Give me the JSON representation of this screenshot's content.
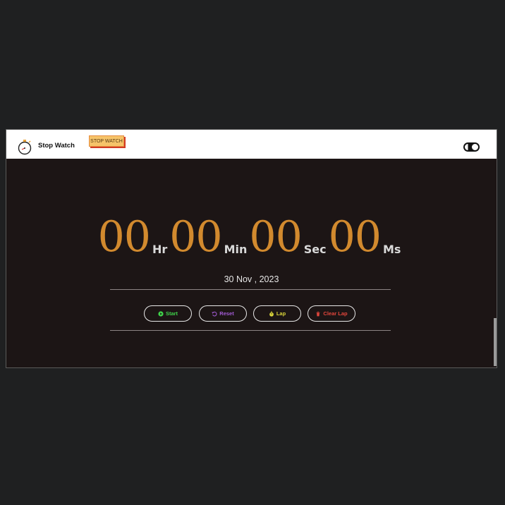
{
  "navbar": {
    "brand": "Stop Watch",
    "tag_label": "STOP WATCH"
  },
  "timer": {
    "hours": "00",
    "hours_unit": "Hr",
    "minutes": "00",
    "minutes_unit": "Min",
    "seconds": "00",
    "seconds_unit": "Sec",
    "milliseconds": "00",
    "milliseconds_unit": "Ms"
  },
  "date": "30 Nov , 2023",
  "controls": {
    "start": {
      "label": "Start",
      "color": "#3fd24a",
      "icon": "play-circle-icon"
    },
    "reset": {
      "label": "Reset",
      "color": "#a35bd6",
      "icon": "reset-icon"
    },
    "lap": {
      "label": "Lap",
      "color": "#d8d33a",
      "icon": "stopwatch-icon"
    },
    "clear_lap": {
      "label": "Clear Lap",
      "color": "#e2463c",
      "icon": "trash-icon"
    }
  },
  "colors": {
    "digits": "#d28a2e",
    "panel_background": "#1c1515",
    "page_background": "#1f2021"
  }
}
